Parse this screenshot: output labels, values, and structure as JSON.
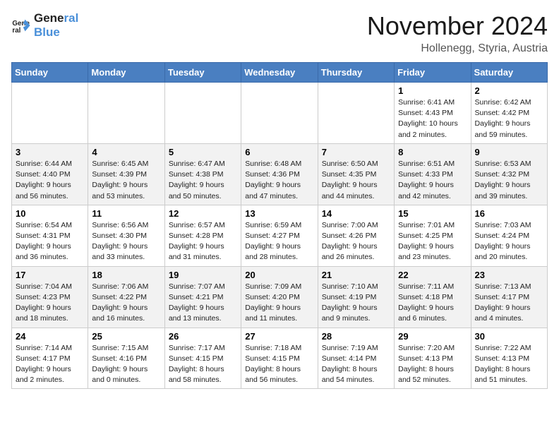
{
  "logo": {
    "line1": "General",
    "line2": "Blue"
  },
  "title": "November 2024",
  "location": "Hollenegg, Styria, Austria",
  "days_of_week": [
    "Sunday",
    "Monday",
    "Tuesday",
    "Wednesday",
    "Thursday",
    "Friday",
    "Saturday"
  ],
  "weeks": [
    [
      {
        "day": "",
        "info": ""
      },
      {
        "day": "",
        "info": ""
      },
      {
        "day": "",
        "info": ""
      },
      {
        "day": "",
        "info": ""
      },
      {
        "day": "",
        "info": ""
      },
      {
        "day": "1",
        "info": "Sunrise: 6:41 AM\nSunset: 4:43 PM\nDaylight: 10 hours\nand 2 minutes."
      },
      {
        "day": "2",
        "info": "Sunrise: 6:42 AM\nSunset: 4:42 PM\nDaylight: 9 hours\nand 59 minutes."
      }
    ],
    [
      {
        "day": "3",
        "info": "Sunrise: 6:44 AM\nSunset: 4:40 PM\nDaylight: 9 hours\nand 56 minutes."
      },
      {
        "day": "4",
        "info": "Sunrise: 6:45 AM\nSunset: 4:39 PM\nDaylight: 9 hours\nand 53 minutes."
      },
      {
        "day": "5",
        "info": "Sunrise: 6:47 AM\nSunset: 4:38 PM\nDaylight: 9 hours\nand 50 minutes."
      },
      {
        "day": "6",
        "info": "Sunrise: 6:48 AM\nSunset: 4:36 PM\nDaylight: 9 hours\nand 47 minutes."
      },
      {
        "day": "7",
        "info": "Sunrise: 6:50 AM\nSunset: 4:35 PM\nDaylight: 9 hours\nand 44 minutes."
      },
      {
        "day": "8",
        "info": "Sunrise: 6:51 AM\nSunset: 4:33 PM\nDaylight: 9 hours\nand 42 minutes."
      },
      {
        "day": "9",
        "info": "Sunrise: 6:53 AM\nSunset: 4:32 PM\nDaylight: 9 hours\nand 39 minutes."
      }
    ],
    [
      {
        "day": "10",
        "info": "Sunrise: 6:54 AM\nSunset: 4:31 PM\nDaylight: 9 hours\nand 36 minutes."
      },
      {
        "day": "11",
        "info": "Sunrise: 6:56 AM\nSunset: 4:30 PM\nDaylight: 9 hours\nand 33 minutes."
      },
      {
        "day": "12",
        "info": "Sunrise: 6:57 AM\nSunset: 4:28 PM\nDaylight: 9 hours\nand 31 minutes."
      },
      {
        "day": "13",
        "info": "Sunrise: 6:59 AM\nSunset: 4:27 PM\nDaylight: 9 hours\nand 28 minutes."
      },
      {
        "day": "14",
        "info": "Sunrise: 7:00 AM\nSunset: 4:26 PM\nDaylight: 9 hours\nand 26 minutes."
      },
      {
        "day": "15",
        "info": "Sunrise: 7:01 AM\nSunset: 4:25 PM\nDaylight: 9 hours\nand 23 minutes."
      },
      {
        "day": "16",
        "info": "Sunrise: 7:03 AM\nSunset: 4:24 PM\nDaylight: 9 hours\nand 20 minutes."
      }
    ],
    [
      {
        "day": "17",
        "info": "Sunrise: 7:04 AM\nSunset: 4:23 PM\nDaylight: 9 hours\nand 18 minutes."
      },
      {
        "day": "18",
        "info": "Sunrise: 7:06 AM\nSunset: 4:22 PM\nDaylight: 9 hours\nand 16 minutes."
      },
      {
        "day": "19",
        "info": "Sunrise: 7:07 AM\nSunset: 4:21 PM\nDaylight: 9 hours\nand 13 minutes."
      },
      {
        "day": "20",
        "info": "Sunrise: 7:09 AM\nSunset: 4:20 PM\nDaylight: 9 hours\nand 11 minutes."
      },
      {
        "day": "21",
        "info": "Sunrise: 7:10 AM\nSunset: 4:19 PM\nDaylight: 9 hours\nand 9 minutes."
      },
      {
        "day": "22",
        "info": "Sunrise: 7:11 AM\nSunset: 4:18 PM\nDaylight: 9 hours\nand 6 minutes."
      },
      {
        "day": "23",
        "info": "Sunrise: 7:13 AM\nSunset: 4:17 PM\nDaylight: 9 hours\nand 4 minutes."
      }
    ],
    [
      {
        "day": "24",
        "info": "Sunrise: 7:14 AM\nSunset: 4:17 PM\nDaylight: 9 hours\nand 2 minutes."
      },
      {
        "day": "25",
        "info": "Sunrise: 7:15 AM\nSunset: 4:16 PM\nDaylight: 9 hours\nand 0 minutes."
      },
      {
        "day": "26",
        "info": "Sunrise: 7:17 AM\nSunset: 4:15 PM\nDaylight: 8 hours\nand 58 minutes."
      },
      {
        "day": "27",
        "info": "Sunrise: 7:18 AM\nSunset: 4:15 PM\nDaylight: 8 hours\nand 56 minutes."
      },
      {
        "day": "28",
        "info": "Sunrise: 7:19 AM\nSunset: 4:14 PM\nDaylight: 8 hours\nand 54 minutes."
      },
      {
        "day": "29",
        "info": "Sunrise: 7:20 AM\nSunset: 4:13 PM\nDaylight: 8 hours\nand 52 minutes."
      },
      {
        "day": "30",
        "info": "Sunrise: 7:22 AM\nSunset: 4:13 PM\nDaylight: 8 hours\nand 51 minutes."
      }
    ]
  ]
}
